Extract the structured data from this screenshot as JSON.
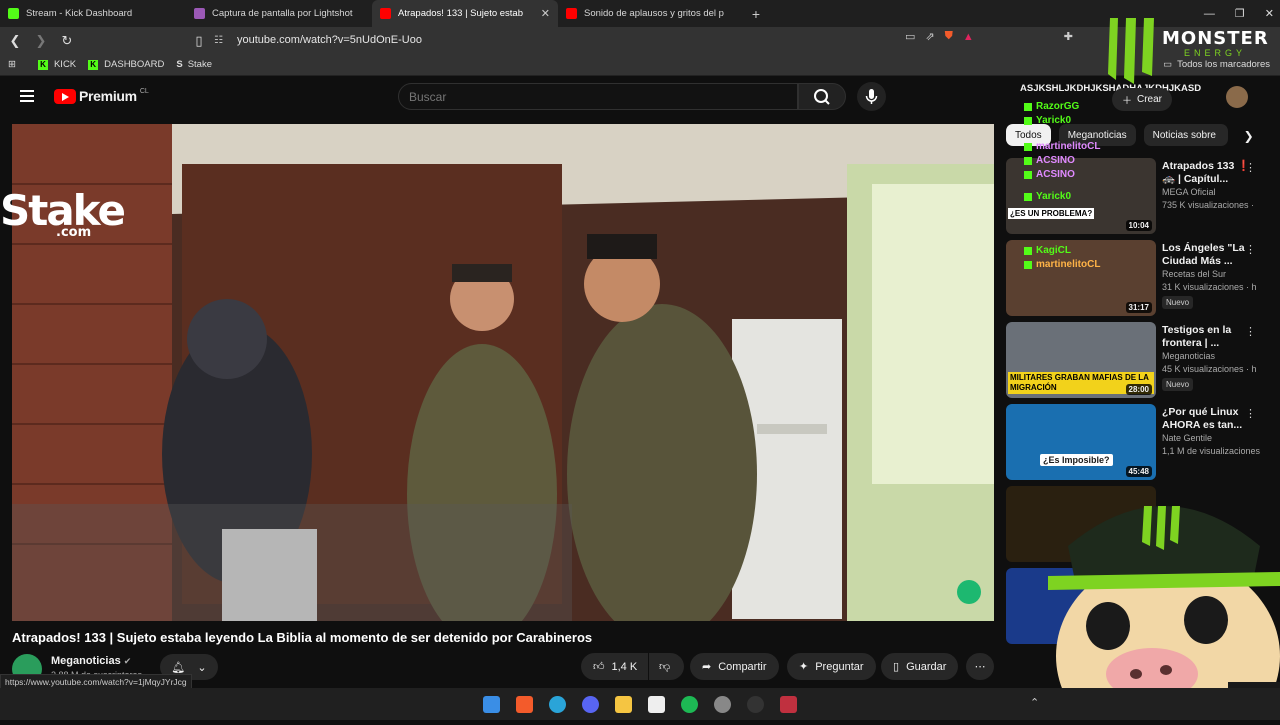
{
  "browser": {
    "tabs": [
      {
        "title": "Stream - Kick Dashboard",
        "icon": "kick-icon",
        "color": "#53fc18"
      },
      {
        "title": "Captura de pantalla por Lightshot",
        "icon": "lightshot-icon",
        "color": "#9b59b6"
      },
      {
        "title": "Atrapados! 133 | Sujeto estab",
        "icon": "youtube-icon",
        "color": "#ff0000",
        "active": true
      },
      {
        "title": "Sonido de aplausos y gritos del p",
        "icon": "youtube-icon",
        "color": "#ff0000"
      }
    ],
    "new_tab": "+",
    "url": "youtube.com/watch?v=5nUdOnE-Uoo",
    "bookmarks": [
      {
        "label": "KICK",
        "icon": "kick-icon"
      },
      {
        "label": "DASHBOARD",
        "icon": "kick-icon"
      },
      {
        "label": "Stake",
        "icon": "stake-icon"
      }
    ],
    "all_bookmarks": "Todos los marcadores",
    "status_url": "https://www.youtube.com/watch?v=1jMqyJYrJcg"
  },
  "youtube": {
    "logo_text": "Premium",
    "logo_region": "CL",
    "search_placeholder": "Buscar",
    "create_label": "Crear"
  },
  "video": {
    "title": "Atrapados! 133 | Sujeto estaba leyendo La Biblia al momento de ser detenido por Carabineros",
    "channel": "Meganoticias",
    "subscribers": "2,88 M de suscriptores",
    "likes": "1,4 K",
    "share_label": "Compartir",
    "ask_label": "Preguntar",
    "save_label": "Guardar"
  },
  "sidebar": {
    "chips": [
      "Todos",
      "Meganoticias",
      "Noticias sobre"
    ],
    "recommendations": [
      {
        "title": "Atrapados 133 ❗ 🚓 | Capítul...",
        "channel": "MEGA Oficial",
        "views": "735 K visualizaciones ·",
        "duration": "10:04",
        "new": false
      },
      {
        "title": "Los Ángeles \"La Ciudad Más ...",
        "channel": "Recetas del Sur",
        "views": "31 K visualizaciones · h",
        "duration": "31:17",
        "new": true
      },
      {
        "title": "Testigos en la frontera | ...",
        "channel": "Meganoticias",
        "views": "45 K visualizaciones · h",
        "duration": "28:00",
        "new": true
      },
      {
        "title": "¿Por qué Linux AHORA es tan...",
        "channel": "Nate Gentile",
        "views": "1,1 M de visualizaciones",
        "duration": "45:48",
        "new": false
      }
    ],
    "new_badge": "Nuevo",
    "thumb_texts": [
      "¿ES UN PROBLEMA?",
      "MILITARES GRABAN MAFIAS DE LA MIGRACIÓN",
      "¿Es Imposible?"
    ]
  },
  "overlay": {
    "stake_brand": "Stake",
    "stake_suffix": ".com",
    "monster_brand": "MONSTER",
    "monster_sub": "ENERGY",
    "chat": [
      {
        "user": "ASJKSHLJKDHJKSHADHAJKDHJKASD"
      },
      {
        "user": "RazorGG"
      },
      {
        "user": "Yarick0"
      },
      {
        "user": "martinelitoCL"
      },
      {
        "user": "ACSINO"
      },
      {
        "user": "ACSINO"
      },
      {
        "user": "Yarick0"
      },
      {
        "user": "KagiCL"
      },
      {
        "user": "martinelitoCL"
      }
    ]
  }
}
